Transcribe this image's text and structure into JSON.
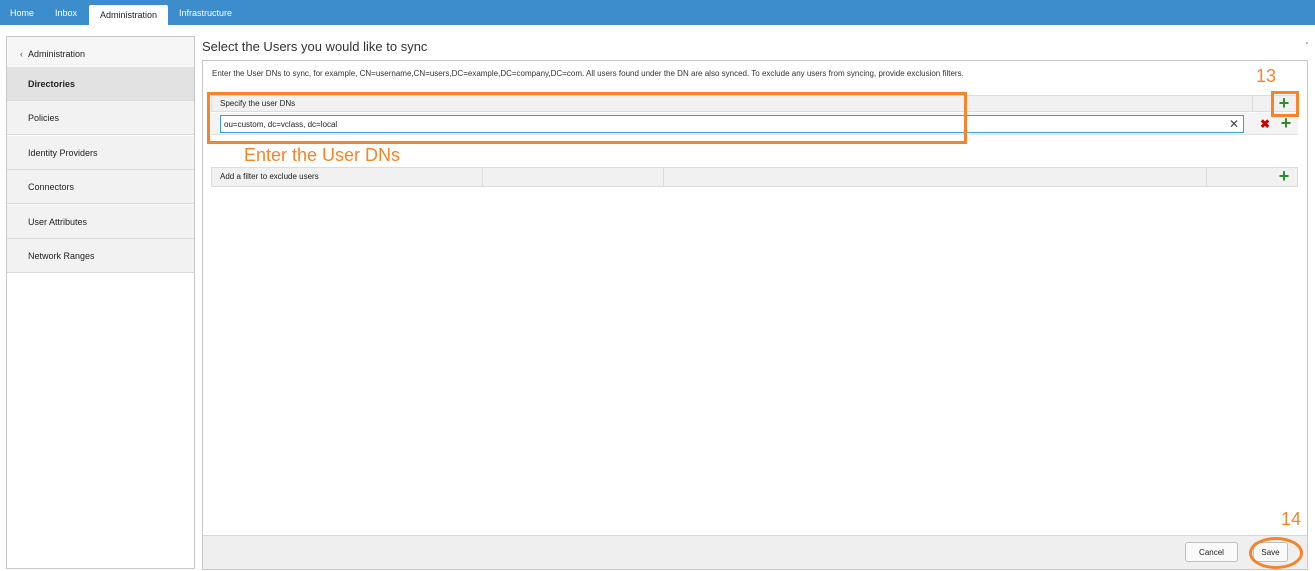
{
  "nav": {
    "tabs": [
      {
        "label": "Home"
      },
      {
        "label": "Inbox"
      },
      {
        "label": "Administration",
        "active": true
      },
      {
        "label": "Infrastructure"
      }
    ]
  },
  "sidebar": {
    "back_glyph": "‹",
    "items": [
      {
        "label": "Administration"
      },
      {
        "label": "Directories",
        "active": true
      },
      {
        "label": "Policies"
      },
      {
        "label": "Identity Providers"
      },
      {
        "label": "Connectors"
      },
      {
        "label": "User Attributes"
      },
      {
        "label": "Network Ranges"
      }
    ]
  },
  "main": {
    "title": "Select the Users you would like to sync",
    "title_tick": "'",
    "instructions": "Enter the User DNs to sync, for example, CN=username,CN=users,DC=example,DC=company,DC=com. All users found under the DN are also synced. To exclude any users from syncing, provide exclusion filters.",
    "user_dns": {
      "header_label": "Specify the user DNs",
      "value": "ou=custom, dc=vclass, dc=local"
    },
    "exclude_filter": {
      "label": "Add a filter to exclude users"
    }
  },
  "icons": {
    "plus": "+",
    "clear": "✕",
    "delete": "✖"
  },
  "annotations": {
    "enter_dns": "Enter the User DNs",
    "step13": "13",
    "step14": "14"
  },
  "footer": {
    "cancel_label": "Cancel",
    "save_label": "Save"
  },
  "colors": {
    "nav_bg": "#3d8ccb",
    "annotation": "#f5842a",
    "add_green": "#2e8b2e",
    "delete_red": "#cc0000",
    "input_focus": "#3aa0d8"
  }
}
